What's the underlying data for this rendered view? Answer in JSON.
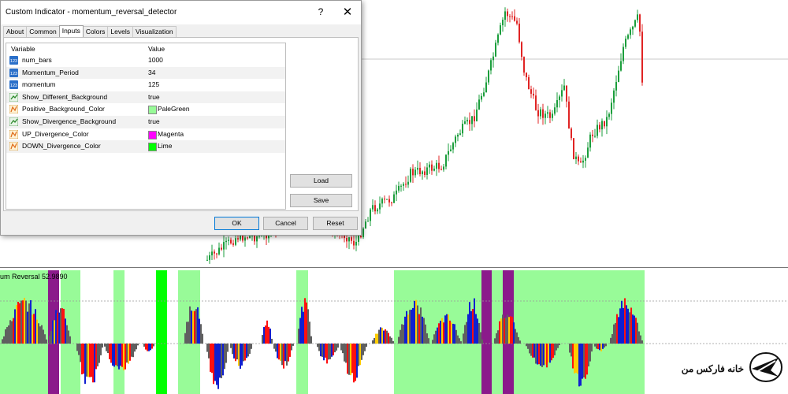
{
  "dialog": {
    "title": "Custom Indicator - momentum_reversal_detector",
    "help_glyph": "?",
    "close_glyph": "✕",
    "tabs": [
      {
        "label": "About",
        "active": false
      },
      {
        "label": "Common",
        "active": false
      },
      {
        "label": "Inputs",
        "active": true
      },
      {
        "label": "Colors",
        "active": false
      },
      {
        "label": "Levels",
        "active": false
      },
      {
        "label": "Visualization",
        "active": false
      }
    ],
    "grid": {
      "col_variable": "Variable",
      "col_value": "Value",
      "rows": [
        {
          "name": "num_bars",
          "value": "1000",
          "icon": "integer-icon"
        },
        {
          "name": "Momentum_Period",
          "value": "34",
          "icon": "integer-icon"
        },
        {
          "name": "momentum",
          "value": "125",
          "icon": "integer-icon"
        },
        {
          "name": "Show_Different_Background",
          "value": "true",
          "icon": "boolean-icon"
        },
        {
          "name": "Positive_Background_Color",
          "value": "PaleGreen",
          "icon": "color-icon",
          "swatch": "#98fb98"
        },
        {
          "name": "Show_Divergence_Background",
          "value": "true",
          "icon": "boolean-icon"
        },
        {
          "name": "UP_Divergence_Color",
          "value": "Magenta",
          "icon": "color-icon",
          "swatch": "#ff00ff"
        },
        {
          "name": "DOWN_Divergence_Color",
          "value": "Lime",
          "icon": "color-icon",
          "swatch": "#00ff00"
        }
      ]
    },
    "buttons": {
      "load": "Load",
      "save": "Save",
      "ok": "OK",
      "cancel": "Cancel",
      "reset": "Reset"
    }
  },
  "subwindow": {
    "label": "um Reversal 52.9890"
  },
  "logo": {
    "text": "خانه فارکس من"
  },
  "colors": {
    "bull_candle": "#1b9e3c",
    "bear_candle": "#e02424",
    "pale_green": "#98fb98",
    "magenta_bg": "#8b1a8b",
    "lime": "#00ff00",
    "hist_gray": "#606060",
    "hist_blue": "#1020d0",
    "hist_red": "#ff1010",
    "hist_yellow": "#ffcc00"
  }
}
